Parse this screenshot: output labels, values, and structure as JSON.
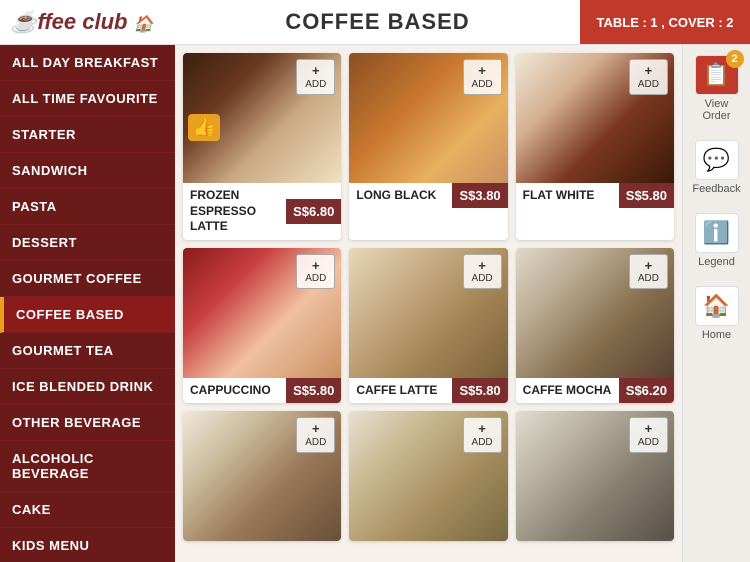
{
  "header": {
    "logo": "☕ffee club",
    "title": "COFFEE BASED",
    "table_info": "TABLE : 1 , COVER : 2"
  },
  "sidebar": {
    "items": [
      {
        "id": "all-day-breakfast",
        "label": "ALL DAY BREAKFAST",
        "active": false
      },
      {
        "id": "all-time-favourite",
        "label": "ALL TIME FAVOURITE",
        "active": false
      },
      {
        "id": "starter",
        "label": "STARTER",
        "active": false
      },
      {
        "id": "sandwich",
        "label": "SANDWICH",
        "active": false
      },
      {
        "id": "pasta",
        "label": "PASTA",
        "active": false
      },
      {
        "id": "dessert",
        "label": "DESSERT",
        "active": false
      },
      {
        "id": "gourmet-coffee",
        "label": "GOURMET COFFEE",
        "active": false
      },
      {
        "id": "coffee-based",
        "label": "COFFEE BASED",
        "active": true
      },
      {
        "id": "gourmet-tea",
        "label": "GOURMET TEA",
        "active": false
      },
      {
        "id": "ice-blended-drink",
        "label": "ICE BLENDED DRINK",
        "active": false
      },
      {
        "id": "other-beverage",
        "label": "OTHER BEVERAGE",
        "active": false
      },
      {
        "id": "alcoholic-beverage",
        "label": "ALCOHOLIC BEVERAGE",
        "active": false
      },
      {
        "id": "cake",
        "label": "CAKE",
        "active": false
      },
      {
        "id": "kids-menu",
        "label": "KIDS MENU",
        "active": false
      }
    ]
  },
  "actions": {
    "view_order": {
      "label": "View Order",
      "badge": "2"
    },
    "feedback": {
      "label": "Feedback"
    },
    "legend": {
      "label": "Legend"
    },
    "home": {
      "label": "Home"
    }
  },
  "menu_items": [
    {
      "id": "frozen-espresso-latte",
      "name": "FROZEN ESPRESSO LATTE",
      "price": "S$6.80",
      "add_label": "ADD",
      "is_fav": true,
      "img_class": "img-frozen"
    },
    {
      "id": "long-black",
      "name": "LONG BLACK",
      "price": "S$3.80",
      "add_label": "ADD",
      "is_fav": false,
      "img_class": "img-longblack"
    },
    {
      "id": "flat-white",
      "name": "FLAT WHITE",
      "price": "S$5.80",
      "add_label": "ADD",
      "is_fav": false,
      "img_class": "img-flatwhite"
    },
    {
      "id": "cappuccino",
      "name": "CAPPUCCINO",
      "price": "S$5.80",
      "add_label": "ADD",
      "is_fav": false,
      "img_class": "img-cappuccino"
    },
    {
      "id": "caffe-latte",
      "name": "CAFFE LATTE",
      "price": "S$5.80",
      "add_label": "ADD",
      "is_fav": false,
      "img_class": "img-caffelatte"
    },
    {
      "id": "caffe-mocha",
      "name": "CAFFE MOCHA",
      "price": "S$6.20",
      "add_label": "ADD",
      "is_fav": false,
      "img_class": "img-caffemocha"
    },
    {
      "id": "item-7",
      "name": "",
      "price": "",
      "add_label": "ADD",
      "is_fav": false,
      "img_class": "img-bottom1"
    },
    {
      "id": "item-8",
      "name": "",
      "price": "",
      "add_label": "ADD",
      "is_fav": false,
      "img_class": "img-bottom2"
    },
    {
      "id": "item-9",
      "name": "",
      "price": "",
      "add_label": "ADD",
      "is_fav": false,
      "img_class": "img-bottom3"
    }
  ]
}
